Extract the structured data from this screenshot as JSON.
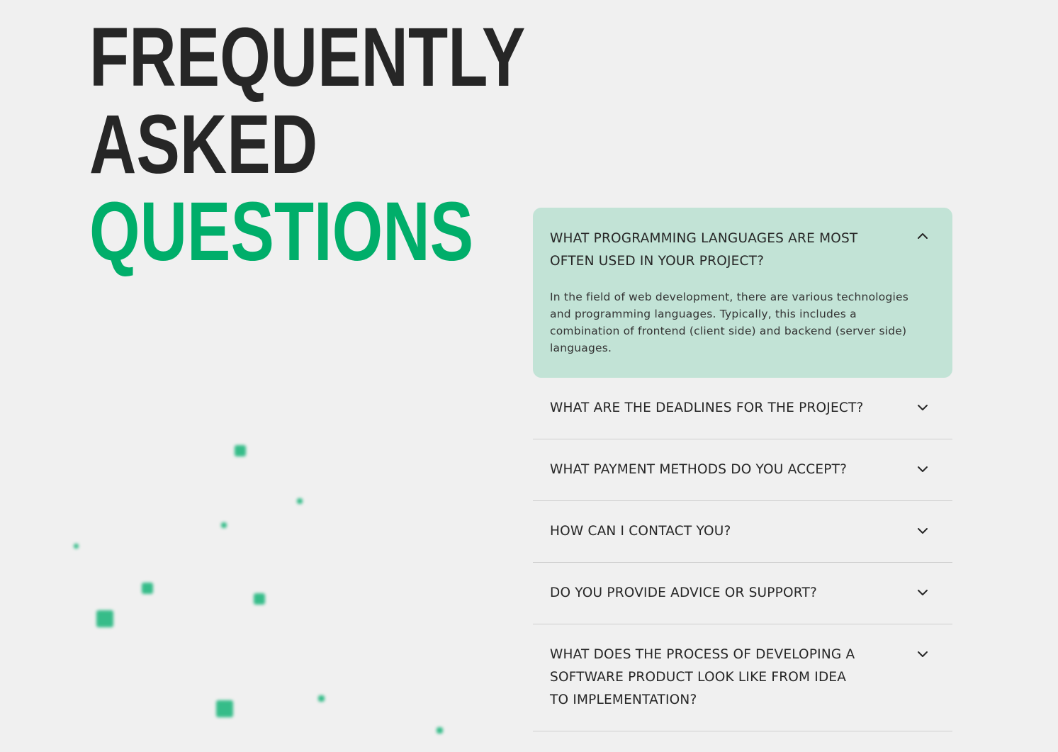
{
  "heading": {
    "line1": "FREQUENTLY",
    "line2": "ASKED",
    "line3": "QUESTIONS"
  },
  "colors": {
    "background": "#f0f0f0",
    "text": "#262626",
    "accent": "#00ae6a",
    "open_panel": "#c2e3d6",
    "divider": "#cfcfcf"
  },
  "faq": {
    "items": [
      {
        "question": "WHAT PROGRAMMING LANGUAGES ARE MOST OFTEN USED IN YOUR PROJECT?",
        "answer": "In the field of web development, there are various technologies and programming languages. Typically, this includes a combination of frontend (client side) and backend (server side) languages.",
        "expanded": true,
        "icon": "chevron-up-icon"
      },
      {
        "question": "WHAT ARE THE DEADLINES FOR THE PROJECT?",
        "expanded": false,
        "icon": "chevron-down-icon"
      },
      {
        "question": "WHAT PAYMENT METHODS DO YOU ACCEPT?",
        "expanded": false,
        "icon": "chevron-down-icon"
      },
      {
        "question": "HOW CAN I CONTACT YOU?",
        "expanded": false,
        "icon": "chevron-down-icon"
      },
      {
        "question": "DO YOU PROVIDE ADVICE OR SUPPORT?",
        "expanded": false,
        "icon": "chevron-down-icon"
      },
      {
        "question": "WHAT DOES THE PROCESS OF DEVELOPING A SOFTWARE PRODUCT LOOK LIKE FROM IDEA TO IMPLEMENTATION?",
        "expanded": false,
        "icon": "chevron-down-icon"
      }
    ]
  }
}
